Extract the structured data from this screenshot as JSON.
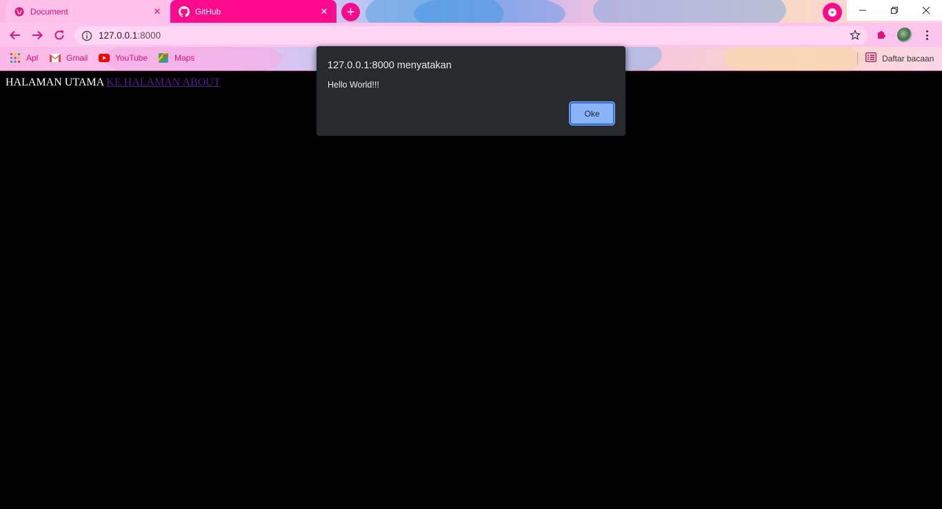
{
  "browser": {
    "tabs": [
      {
        "title": "Document",
        "icon": "globe-icon",
        "active": false
      },
      {
        "title": "GitHub",
        "icon": "github-icon",
        "active": true
      }
    ],
    "close_glyph": "✕",
    "new_tab_glyph": "+",
    "address": {
      "host": "127.0.0.1",
      "port": ":8000"
    },
    "bookmarks": [
      {
        "label": "Apl",
        "icon": "apps-grid-icon"
      },
      {
        "label": "Gmail",
        "icon": "gmail-icon"
      },
      {
        "label": "YouTube",
        "icon": "youtube-icon"
      },
      {
        "label": "Maps",
        "icon": "maps-icon"
      }
    ],
    "reading_list": "Daftar bacaan",
    "accent_color": "#ff0a8c"
  },
  "page": {
    "heading_text": "HALAMAN UTAMA",
    "link_text": "KE HALAMAN ABOUT"
  },
  "dialog": {
    "title": "127.0.0.1:8000 menyatakan",
    "message": "Hello World!!!",
    "ok_label": "Oke"
  }
}
